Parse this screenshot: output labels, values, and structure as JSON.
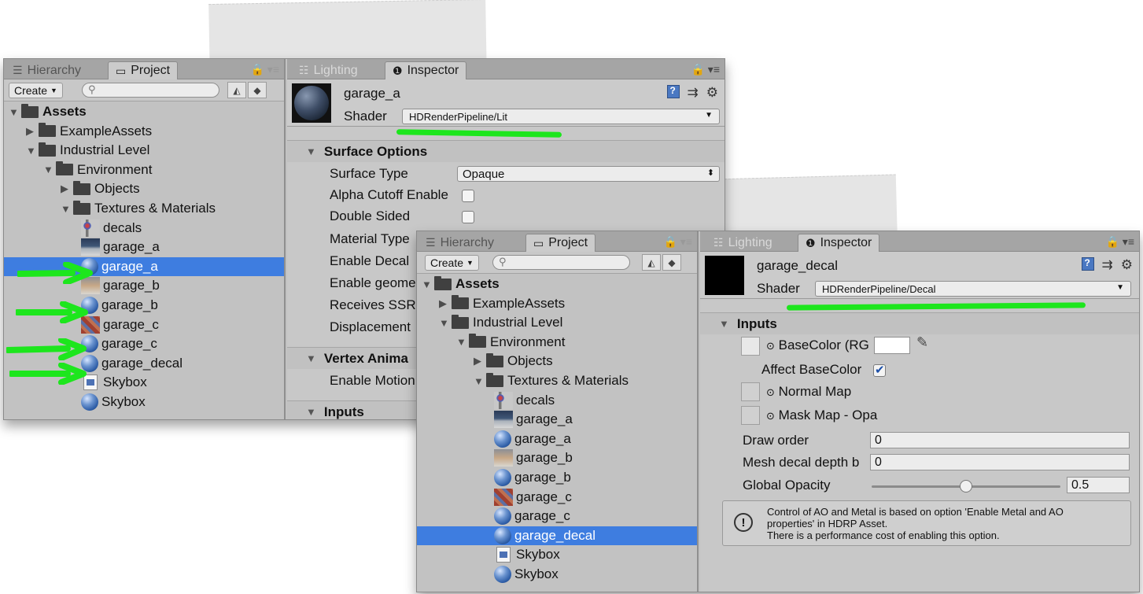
{
  "colors": {
    "selection": "#3e7de0",
    "annotation_green": "#1de61d",
    "panel_bg": "#c2c2c2",
    "folder": "#404040"
  },
  "left_window": {
    "tabs": {
      "hierarchy": "Hierarchy",
      "project": "Project",
      "lighting": "Lighting",
      "inspector": "Inspector"
    },
    "toolbar": {
      "create": "Create",
      "search_placeholder": ""
    },
    "tree": [
      {
        "label": "Assets",
        "icon": "folder-icon"
      },
      {
        "label": "ExampleAssets",
        "icon": "folder-icon"
      },
      {
        "label": "Industrial Level",
        "icon": "folder-icon"
      },
      {
        "label": "Environment",
        "icon": "folder-icon"
      },
      {
        "label": "Objects",
        "icon": "folder-icon"
      },
      {
        "label": "Textures & Materials",
        "icon": "folder-icon"
      },
      {
        "label": "decals",
        "icon": "texture-icon"
      },
      {
        "label": "garage_a",
        "icon": "texture-icon"
      },
      {
        "label": "garage_a",
        "icon": "material-icon",
        "selected": true
      },
      {
        "label": "garage_b",
        "icon": "texture-icon"
      },
      {
        "label": "garage_b",
        "icon": "material-icon"
      },
      {
        "label": "garage_c",
        "icon": "texture-icon"
      },
      {
        "label": "garage_c",
        "icon": "material-icon"
      },
      {
        "label": "garage_decal",
        "icon": "material-icon"
      },
      {
        "label": "Skybox",
        "icon": "skybox-icon"
      },
      {
        "label": "Skybox",
        "icon": "material-icon"
      }
    ],
    "inspector": {
      "material_name": "garage_a",
      "shader_label": "Shader",
      "shader_value": "HDRenderPipeline/Lit",
      "surface_options_title": "Surface Options",
      "surface_type_label": "Surface Type",
      "surface_type_value": "Opaque",
      "alpha_cutoff_label": "Alpha Cutoff Enable",
      "double_sided_label": "Double Sided",
      "material_type_label": "Material Type",
      "enable_decal_label": "Enable Decal",
      "enable_geom_label": "Enable geome",
      "receives_ssr_label": "Receives SSR",
      "displacement_label": "Displacement",
      "vertex_anim_title": "Vertex Anima",
      "enable_motion_label": "Enable Motion",
      "inputs_title": "Inputs"
    }
  },
  "right_window": {
    "tabs": {
      "hierarchy": "Hierarchy",
      "project": "Project",
      "lighting": "Lighting",
      "inspector": "Inspector"
    },
    "toolbar": {
      "create": "Create",
      "search_placeholder": ""
    },
    "tree": [
      {
        "label": "Assets",
        "icon": "folder-icon"
      },
      {
        "label": "ExampleAssets",
        "icon": "folder-icon"
      },
      {
        "label": "Industrial Level",
        "icon": "folder-icon"
      },
      {
        "label": "Environment",
        "icon": "folder-icon"
      },
      {
        "label": "Objects",
        "icon": "folder-icon"
      },
      {
        "label": "Textures & Materials",
        "icon": "folder-icon"
      },
      {
        "label": "decals",
        "icon": "texture-icon"
      },
      {
        "label": "garage_a",
        "icon": "texture-icon"
      },
      {
        "label": "garage_a",
        "icon": "material-icon"
      },
      {
        "label": "garage_b",
        "icon": "texture-icon"
      },
      {
        "label": "garage_b",
        "icon": "material-icon"
      },
      {
        "label": "garage_c",
        "icon": "texture-icon"
      },
      {
        "label": "garage_c",
        "icon": "material-icon"
      },
      {
        "label": "garage_decal",
        "icon": "material-icon",
        "selected": true
      },
      {
        "label": "Skybox",
        "icon": "skybox-icon"
      },
      {
        "label": "Skybox",
        "icon": "material-icon"
      }
    ],
    "inspector": {
      "material_name": "garage_decal",
      "shader_label": "Shader",
      "shader_value": "HDRenderPipeline/Decal",
      "inputs_title": "Inputs",
      "base_color_label": "BaseColor (RG",
      "affect_base_color_label": "Affect BaseColor",
      "affect_base_color_checked": true,
      "normal_map_label": "Normal Map",
      "mask_map_label": "Mask Map - Opa",
      "draw_order_label": "Draw order",
      "draw_order_value": "0",
      "mesh_decal_label": "Mesh decal depth b",
      "mesh_decal_value": "0",
      "global_opacity_label": "Global Opacity",
      "global_opacity_value": "0.5",
      "global_opacity_fraction": 0.5,
      "help_line1": "Control of AO and Metal is based on option 'Enable Metal and AO",
      "help_line2": "properties' in HDRP Asset.",
      "help_line3": "There is a performance cost of enabling this option."
    }
  }
}
